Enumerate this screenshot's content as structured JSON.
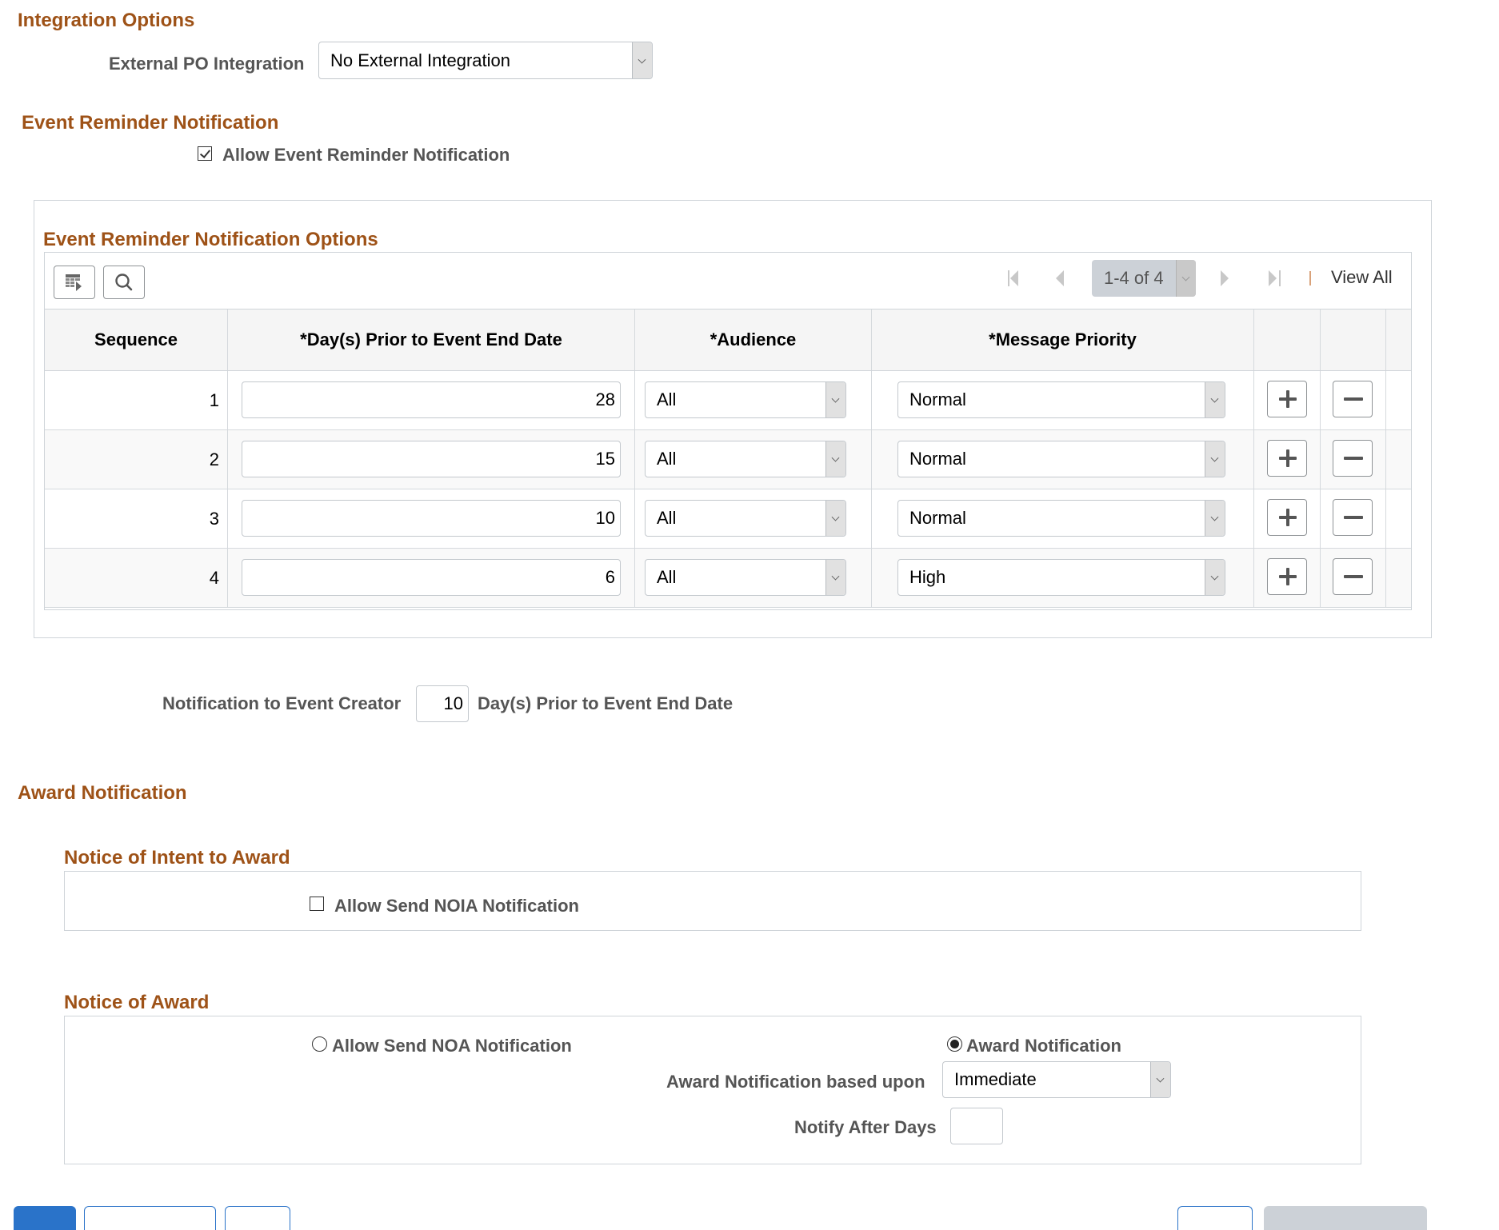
{
  "integration": {
    "title": "Integration Options",
    "external_po_label": "External PO Integration",
    "external_po_value": "No External Integration"
  },
  "event_reminder": {
    "title": "Event Reminder Notification",
    "allow_label": "Allow Event Reminder Notification",
    "allow_checked": true,
    "options_title": "Event Reminder Notification Options",
    "toolbar": {
      "personalize_icon": "grid-personalize-icon",
      "find_icon": "search-icon"
    },
    "pager": {
      "range_text": "1-4 of 4",
      "view_all": "View All",
      "separator": "|"
    },
    "columns": [
      "Sequence",
      "*Day(s) Prior to Event End Date",
      "*Audience",
      "*Message Priority"
    ],
    "rows": [
      {
        "sequence": "1",
        "days": "28",
        "audience": "All",
        "priority": "Normal"
      },
      {
        "sequence": "2",
        "days": "15",
        "audience": "All",
        "priority": "Normal"
      },
      {
        "sequence": "3",
        "days": "10",
        "audience": "All",
        "priority": "Normal"
      },
      {
        "sequence": "4",
        "days": "6",
        "audience": "All",
        "priority": "High"
      }
    ],
    "creator_label": "Notification to Event Creator",
    "creator_days": "10",
    "creator_suffix": "Day(s) Prior to Event End Date"
  },
  "award": {
    "title": "Award Notification",
    "noia": {
      "title": "Notice of Intent to Award",
      "allow_label": "Allow Send NOIA Notification",
      "allow_checked": false
    },
    "noa": {
      "title": "Notice of Award",
      "allow_noa_label": "Allow Send NOA Notification",
      "allow_noa_selected": false,
      "award_notification_label": "Award Notification",
      "award_notification_selected": true,
      "based_upon_label": "Award Notification based upon",
      "based_upon_value": "Immediate",
      "notify_after_label": "Notify After Days",
      "notify_after_value": ""
    }
  },
  "colors": {
    "section_title": "#9e5217",
    "primary_button": "#2a73c9",
    "disabled_button": "#ccd1d7"
  }
}
